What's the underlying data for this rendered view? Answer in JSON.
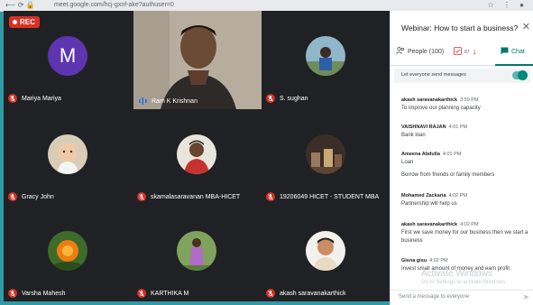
{
  "browser": {
    "url": "meet.google.com/hcj-gxnf-ake?authuser=0"
  },
  "recording": {
    "label": "REC"
  },
  "participants": [
    {
      "name": "Mariya Mariya",
      "avatar_letter": "M",
      "muted": true
    },
    {
      "name": "Ram K Krishnan",
      "muted": false,
      "speaking": true
    },
    {
      "name": "S. sughan",
      "muted": true
    },
    {
      "name": "Gracy John",
      "muted": true
    },
    {
      "name": "skamalasaravanan MBA-HICET",
      "muted": true
    },
    {
      "name": "19206049 HICET - STUDENT MBA",
      "muted": true
    },
    {
      "name": "Varsha Mahesh",
      "muted": true
    },
    {
      "name": "KARTHIKA M",
      "muted": true
    },
    {
      "name": "akash saravanakarthick",
      "muted": true
    }
  ],
  "panel": {
    "title": "Webinar: How to start a business?",
    "tabs": {
      "people": "People (100)",
      "raise_count": "87",
      "chat": "Chat"
    },
    "toggle_label": "Let everyone send messages",
    "toggle_on": true,
    "messages": [
      {
        "sender": "akash saravanakarthick",
        "time": "3:59 PM",
        "text": "To improve our planning capacity"
      },
      {
        "sender": "VAISHNAVI RAJAN",
        "time": "4:01 PM",
        "text": "Bank loan"
      },
      {
        "sender": "Ameena Abdulla",
        "time": "4:01 PM",
        "text": "Loan",
        "text2": "Borrow from friends or family members"
      },
      {
        "sender": "Mohamed Zackaria",
        "time": "4:02 PM",
        "text": "Partnership will help us"
      },
      {
        "sender": "akash saravanakarthick",
        "time": "4:02 PM",
        "text": "First we save money for our business then we start a business"
      },
      {
        "sender": "Gisna gisu",
        "time": "4:02 PM",
        "text": "Invest small amount of money and earn profit"
      }
    ],
    "activate_title": "Activate Windows",
    "activate_sub": "Go to Settings to activate Windows.",
    "send_placeholder": "Send a message to everyone"
  },
  "colors": {
    "accent": "#00796b",
    "muted_red": "#d93025",
    "tile_bg": "#202124"
  }
}
